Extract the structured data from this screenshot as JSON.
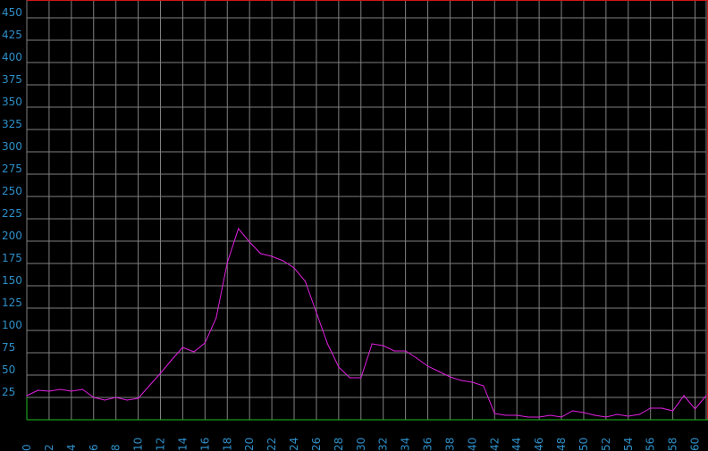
{
  "chart_data": {
    "type": "line",
    "title": "",
    "xlabel": "",
    "ylabel": "",
    "xlim": [
      0,
      61
    ],
    "ylim": [
      0,
      470
    ],
    "grid": true,
    "x_ticks": [
      "0",
      "2",
      "4",
      "6",
      "8",
      "10",
      "12",
      "14",
      "16",
      "18",
      "20",
      "22",
      "24",
      "26",
      "28",
      "30",
      "32",
      "34",
      "36",
      "38",
      "40",
      "42",
      "44",
      "46",
      "48",
      "50",
      "52",
      "54",
      "56",
      "58",
      "60"
    ],
    "y_ticks": [
      "25",
      "50",
      "75",
      "100",
      "125",
      "150",
      "175",
      "200",
      "225",
      "250",
      "275",
      "300",
      "325",
      "350",
      "375",
      "400",
      "425",
      "450"
    ],
    "colors": {
      "background": "#000000",
      "grid": "#808080",
      "axis_top": "#d01818",
      "axis_bottom": "#20c020",
      "tick_label": "#2e8fc8",
      "line": "#e020e0"
    },
    "series": [
      {
        "x": [
          0,
          1,
          2,
          3,
          4,
          5,
          6,
          7,
          8,
          9,
          10,
          11,
          12,
          13,
          14,
          15,
          16,
          17,
          18,
          19,
          20,
          21,
          22,
          23,
          24,
          25,
          26,
          27,
          28,
          29,
          30,
          31,
          32,
          33,
          34,
          35,
          36,
          37,
          38,
          39,
          40,
          41,
          42,
          43,
          44,
          45,
          46,
          47,
          48,
          49,
          50,
          51,
          52,
          53,
          54,
          55,
          56,
          57,
          58,
          59,
          60,
          61
        ],
        "values": [
          27,
          33,
          32,
          34,
          32,
          34,
          25,
          22,
          25,
          22,
          24,
          38,
          52,
          67,
          81,
          76,
          86,
          114,
          176,
          214,
          199,
          186,
          183,
          178,
          170,
          155,
          120,
          85,
          59,
          47,
          47,
          85,
          83,
          77,
          77,
          69,
          60,
          54,
          48,
          44,
          42,
          38,
          7,
          5,
          5,
          3,
          3,
          5,
          3,
          10,
          8,
          5,
          3,
          6,
          4,
          6,
          13,
          13,
          10,
          27,
          12,
          27
        ]
      }
    ]
  }
}
